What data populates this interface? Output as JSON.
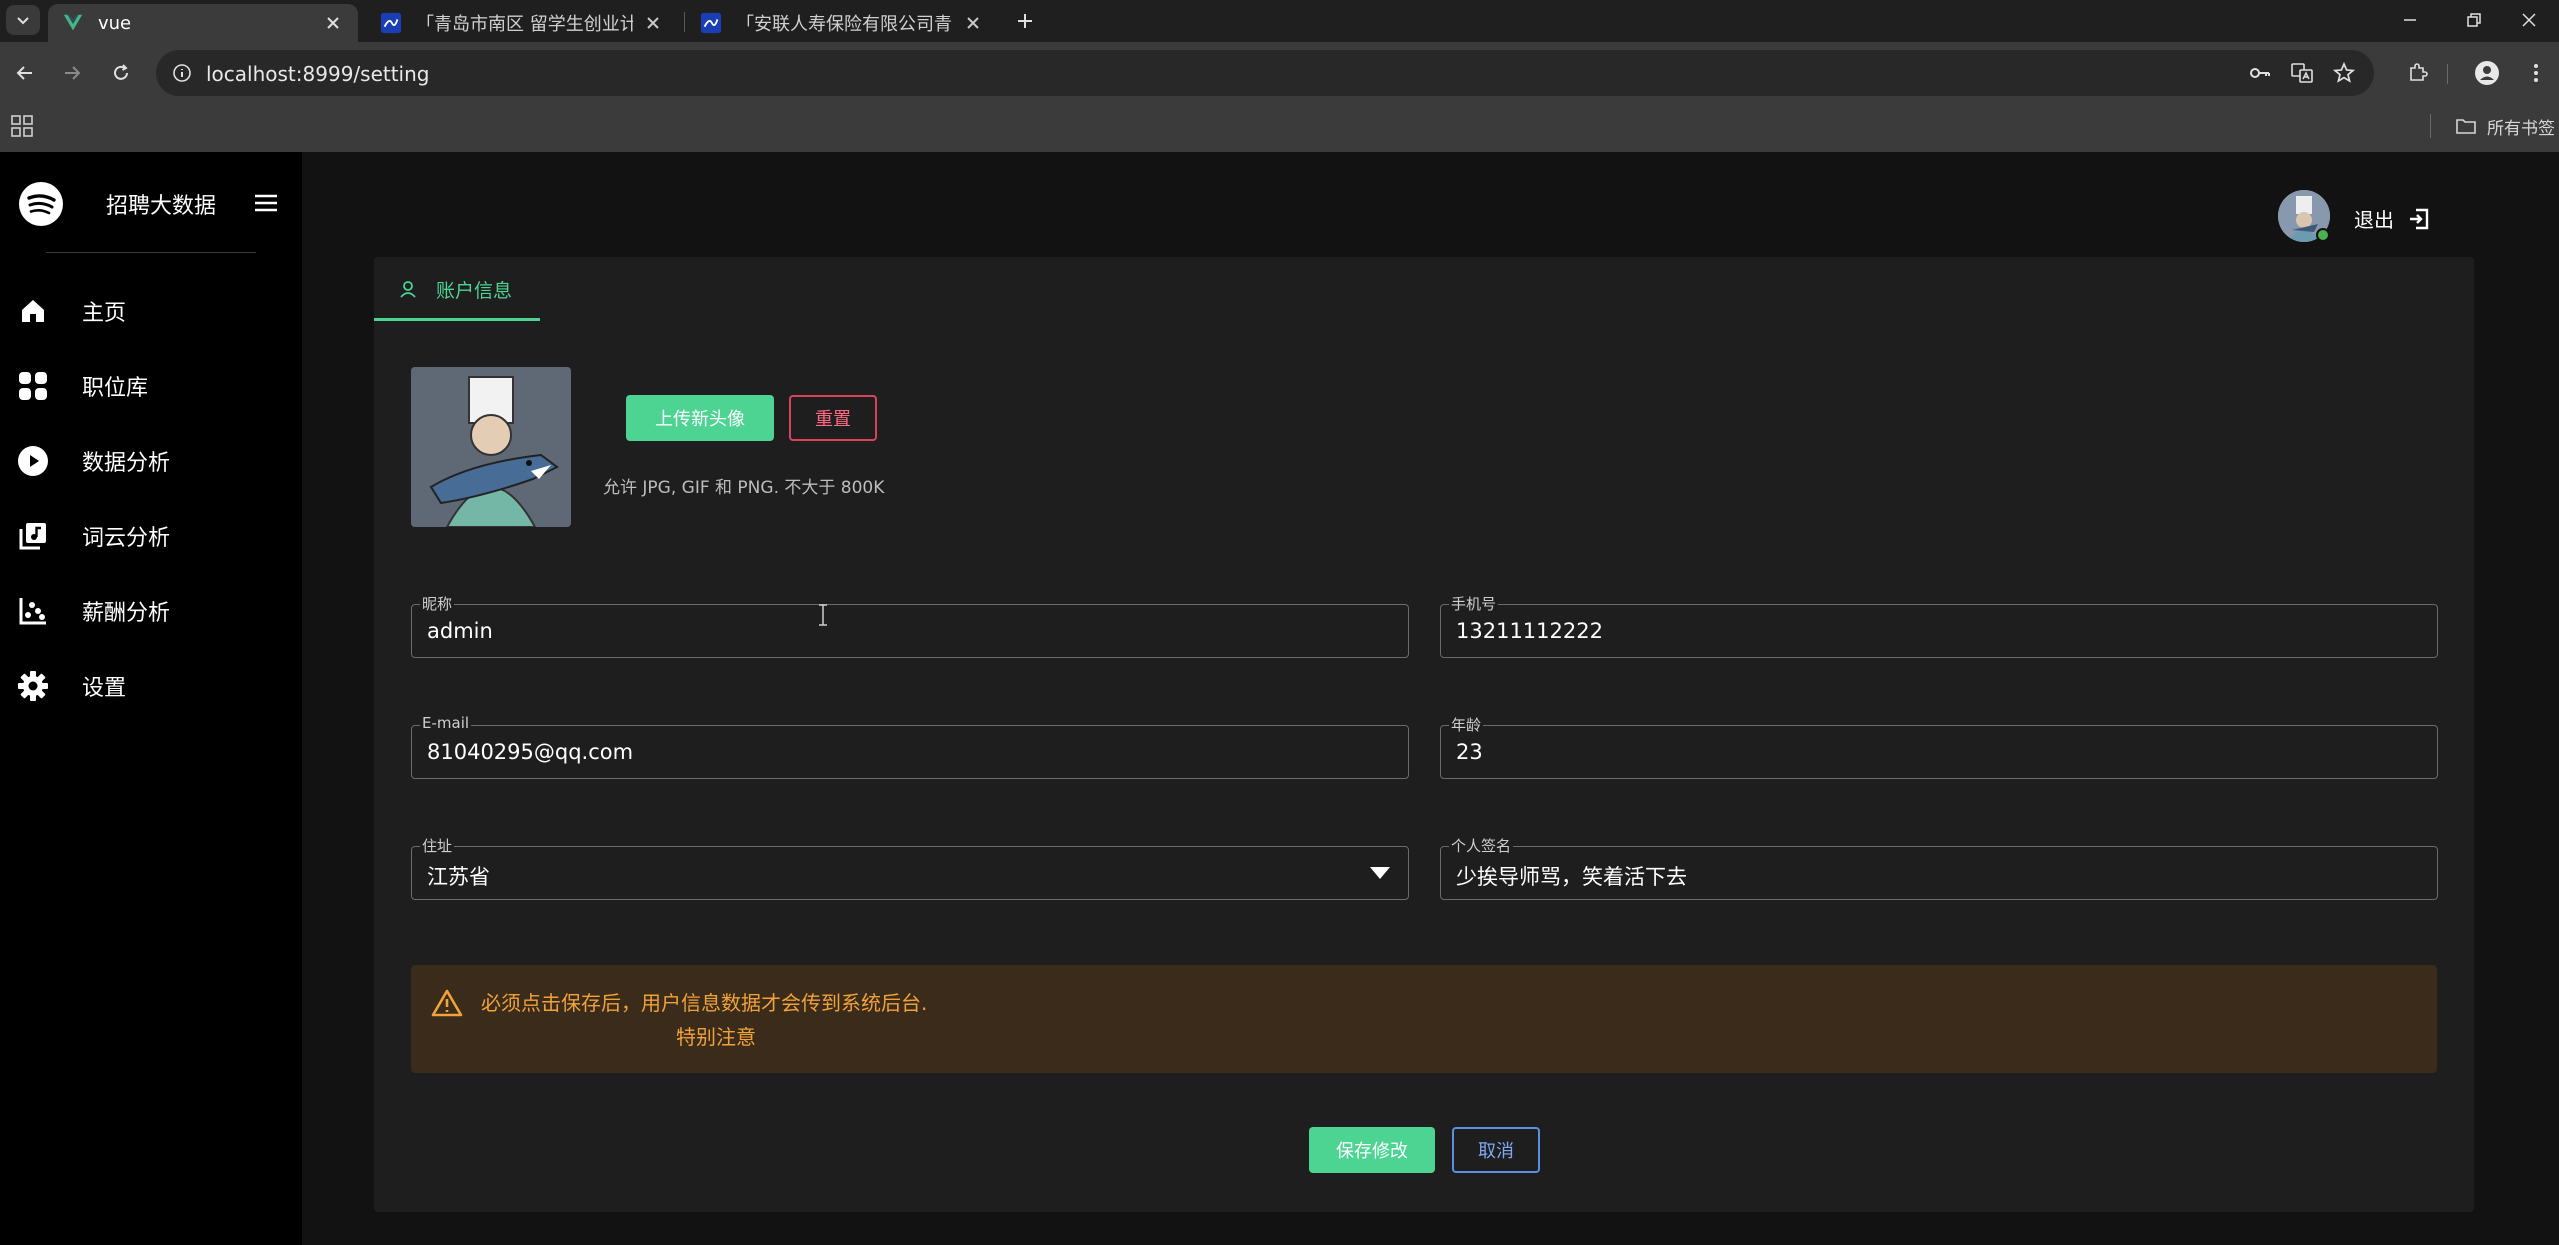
{
  "browser": {
    "tabs": [
      {
        "title": "vue",
        "active": true
      },
      {
        "title": "「青岛市南区 留学生创业计划」",
        "active": false
      },
      {
        "title": "「安联人寿保险有限公司青岛分",
        "active": false
      }
    ],
    "url": "localhost:8999/setting",
    "bookmarks_all": "所有书签"
  },
  "sidebar": {
    "brand": "招聘大数据",
    "items": [
      {
        "label": "主页",
        "icon": "home-icon"
      },
      {
        "label": "职位库",
        "icon": "grid-icon"
      },
      {
        "label": "数据分析",
        "icon": "play-circle-icon"
      },
      {
        "label": "词云分析",
        "icon": "library-music-icon"
      },
      {
        "label": "薪酬分析",
        "icon": "scatter-chart-icon"
      },
      {
        "label": "设置",
        "icon": "gear-icon"
      }
    ]
  },
  "header": {
    "logout_label": "退出"
  },
  "account": {
    "tab_label": "账户信息",
    "upload_label": "上传新头像",
    "reset_label": "重置",
    "hint": "允许 JPG, GIF 和 PNG. 不大于 800K",
    "fields": {
      "nickname": {
        "label": "昵称",
        "value": "admin"
      },
      "phone": {
        "label": "手机号",
        "value": "13211112222"
      },
      "email": {
        "label": "E-mail",
        "value": "81040295@qq.com"
      },
      "age": {
        "label": "年龄",
        "value": "23"
      },
      "address": {
        "label": "住址",
        "value": "江苏省"
      },
      "signature": {
        "label": "个人签名",
        "value": "少挨导师骂，笑着活下去"
      }
    },
    "alert": {
      "message": "必须点击保存后，用户信息数据才会传到系统后台.",
      "sub": "特别注意"
    },
    "save_label": "保存修改",
    "cancel_label": "取消"
  },
  "colors": {
    "accent": "#4dd493",
    "danger": "#d6455d",
    "info": "#5a8ee0",
    "warning_text": "#f0a23b",
    "warning_bg": "#3b2b1a"
  }
}
